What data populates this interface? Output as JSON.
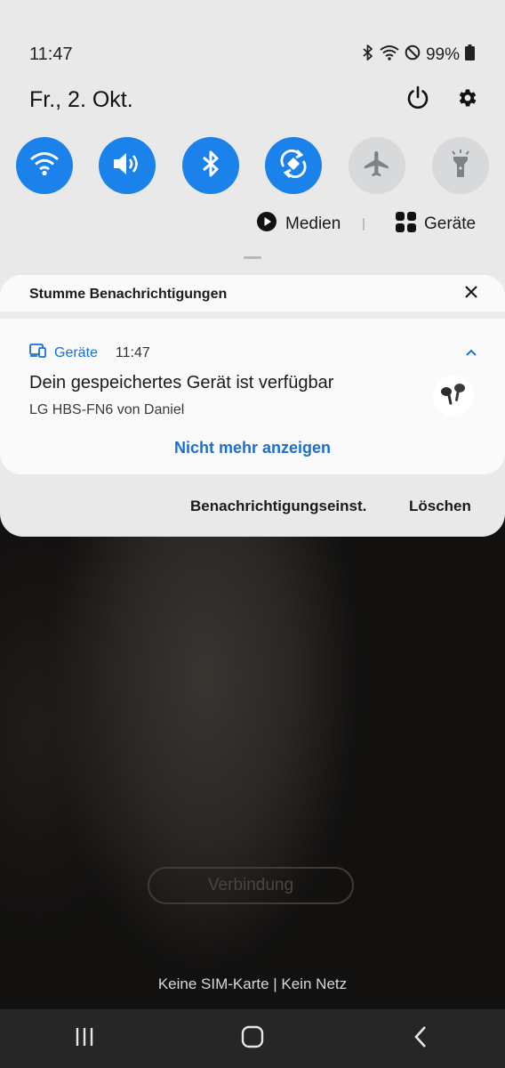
{
  "status_bar": {
    "time": "11:47",
    "battery": "99%",
    "icons": [
      "bluetooth-icon",
      "wifi-icon",
      "do-not-disturb-icon",
      "battery-icon"
    ]
  },
  "header": {
    "date": "Fr., 2. Okt.",
    "power_icon": "power-icon",
    "settings_icon": "gear-icon"
  },
  "quick_tiles": [
    {
      "name": "wifi",
      "icon": "wifi-icon",
      "state": "on"
    },
    {
      "name": "sound",
      "icon": "speaker-icon",
      "state": "on"
    },
    {
      "name": "bluetooth",
      "icon": "bluetooth-icon",
      "state": "on"
    },
    {
      "name": "auto-rotate",
      "icon": "rotate-icon",
      "state": "on"
    },
    {
      "name": "airplane",
      "icon": "airplane-icon",
      "state": "off"
    },
    {
      "name": "flashlight",
      "icon": "flashlight-icon",
      "state": "off"
    }
  ],
  "media_bar": {
    "media_label": "Medien",
    "devices_label": "Geräte"
  },
  "notification_card": {
    "section_title": "Stumme Benachrichtigungen",
    "app_name": "Geräte",
    "time": "11:47",
    "title": "Dein gespeichertes Gerät ist verfügbar",
    "subtitle": "LG HBS-FN6 von Daniel",
    "action": "Nicht mehr anzeigen"
  },
  "panel_footer": {
    "settings": "Benachrichtigungseinst.",
    "clear": "Löschen"
  },
  "lockscreen": {
    "connect_button": "Verbindung",
    "sim_status": "Keine SIM-Karte | Kein Netz"
  },
  "colors": {
    "accent": "#1a82ea",
    "link": "#1a6fd0",
    "panel": "#e9e9ea",
    "tile_off": "#d8d9db"
  }
}
